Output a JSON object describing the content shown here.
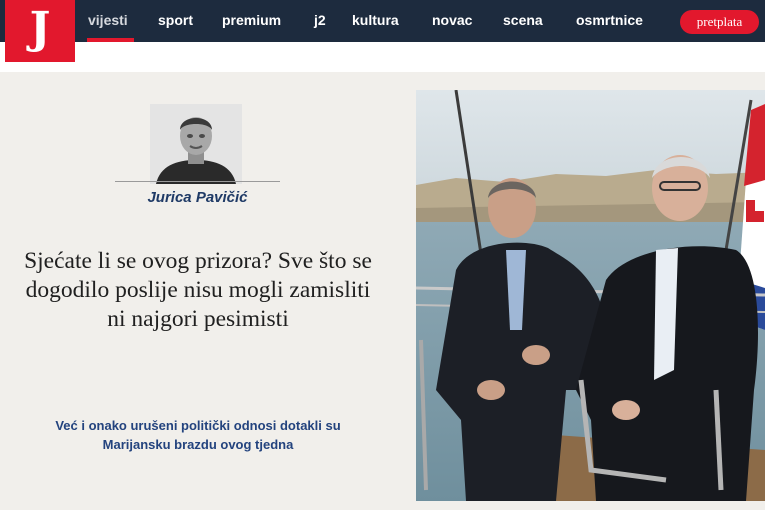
{
  "brand": {
    "logo_letter": "J",
    "accent": "#e2182d",
    "nav_bg": "#1d2b3e"
  },
  "nav": {
    "items": [
      {
        "label": "vijesti",
        "active": true
      },
      {
        "label": "sport"
      },
      {
        "label": "premium"
      },
      {
        "label": "j2"
      },
      {
        "label": "kultura"
      },
      {
        "label": "novac"
      },
      {
        "label": "scena"
      },
      {
        "label": "osmrtnice"
      }
    ],
    "subscribe_label": "pretplata"
  },
  "article": {
    "author": "Jurica Pavičić",
    "headline": "Sjećate li se ovog prizora? Sve što se dogodilo poslije nisu mogli zamisliti ni najgori pesimisti",
    "lead": "Već i onako urušeni politički odnosi dotakli su Marijansku brazdu ovog tjedna"
  }
}
